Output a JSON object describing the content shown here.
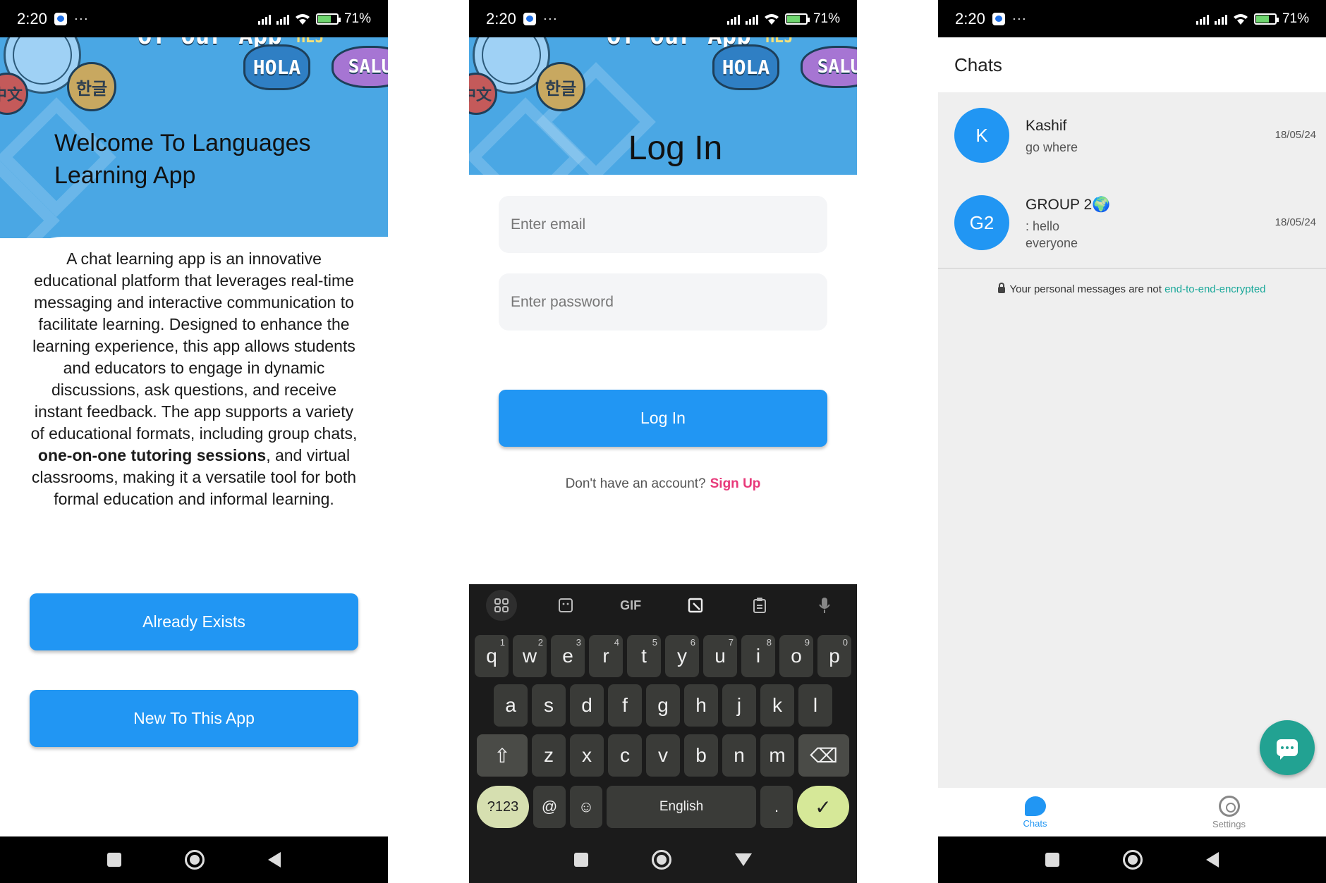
{
  "status_bar": {
    "time": "2:20",
    "dots": "···",
    "battery": "71%"
  },
  "screen1": {
    "hero_text": {
      "top": "of our App",
      "hola": "HOLA",
      "salu": "SALU",
      "hangul": "한글",
      "zh": "中文",
      "rej": "HEJ"
    },
    "welcome_title": "Welcome To Languages Learning App",
    "description_part1": "A chat learning app is an innovative educational platform that leverages real-time messaging and interactive communication to facilitate learning. Designed to enhance the learning experience, this app allows students and educators to engage in dynamic discussions, ask questions, and receive instant feedback. The app supports a variety of educational formats, including group chats, ",
    "description_bold": "one-on-one tutoring sessions",
    "description_part2": ", and virtual classrooms, making it a versatile tool for both formal education and informal learning.",
    "btn_exists": "Already Exists",
    "btn_new": "New To This App"
  },
  "screen2": {
    "title": "Log In",
    "email_placeholder": "Enter email",
    "password_placeholder": "Enter password",
    "login_button": "Log In",
    "no_account": "Don't have an account?",
    "signup_link": "Sign Up",
    "keyboard": {
      "tool_gif": "GIF",
      "row1": [
        [
          "q",
          "1"
        ],
        [
          "w",
          "2"
        ],
        [
          "e",
          "3"
        ],
        [
          "r",
          "4"
        ],
        [
          "t",
          "5"
        ],
        [
          "y",
          "6"
        ],
        [
          "u",
          "7"
        ],
        [
          "i",
          "8"
        ],
        [
          "o",
          "9"
        ],
        [
          "p",
          "0"
        ]
      ],
      "row2": [
        "a",
        "s",
        "d",
        "f",
        "g",
        "h",
        "j",
        "k",
        "l"
      ],
      "row3": [
        "z",
        "x",
        "c",
        "v",
        "b",
        "n",
        "m"
      ],
      "num_key": "?123",
      "at_key": "@",
      "emoji_key": "☺",
      "space_label": "English",
      "period_key": ".",
      "enter_key": "✓",
      "shift_key": "⇧",
      "backspace_key": "⌫"
    }
  },
  "screen3": {
    "title": "Chats",
    "chats": [
      {
        "avatar": "K",
        "name": "Kashif",
        "preview": "go where",
        "date": "18/05/24"
      },
      {
        "avatar": "G2",
        "name": "GROUP 2🌍",
        "preview": ": hello everyone",
        "date": "18/05/24"
      }
    ],
    "encrypt_text": "Your personal messages are not",
    "encrypt_link": "end-to-end-encrypted",
    "tabs": {
      "chats": "Chats",
      "settings": "Settings"
    }
  }
}
